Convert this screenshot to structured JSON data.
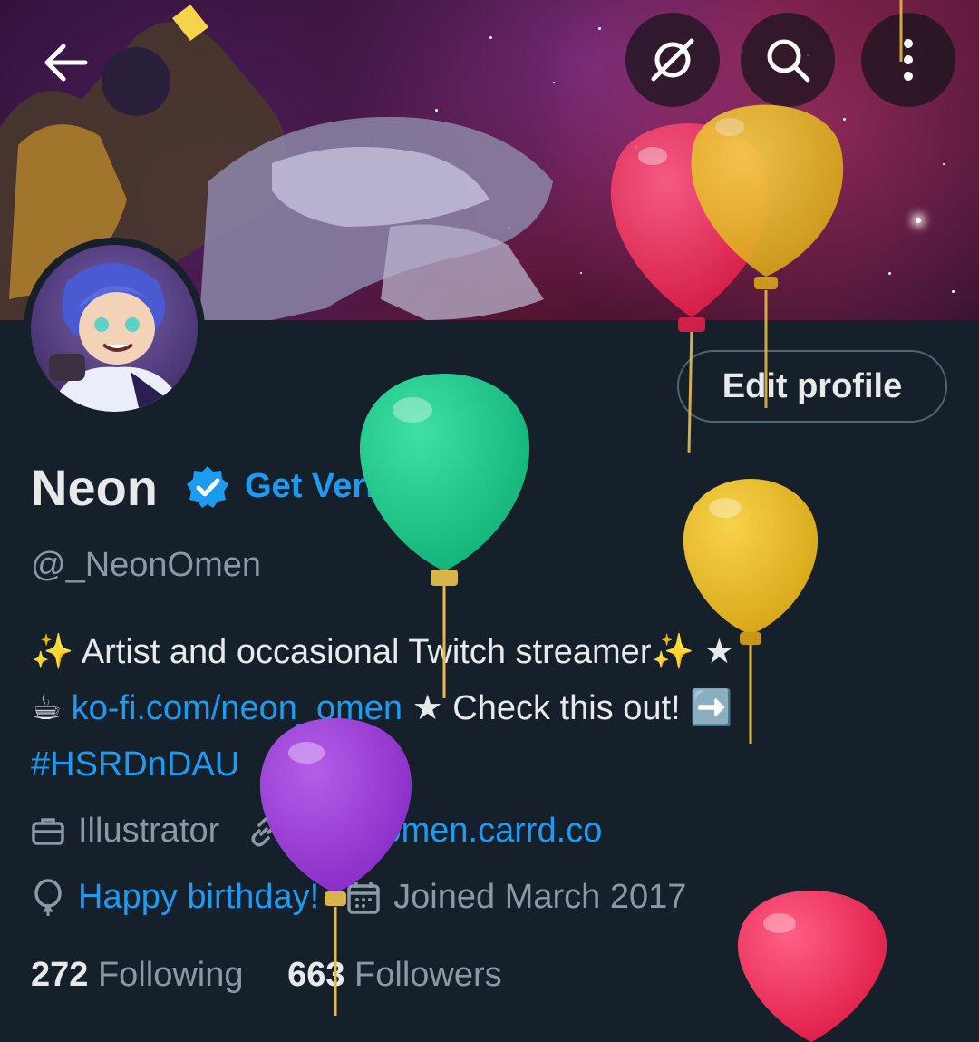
{
  "profile": {
    "name": "Neon",
    "verify_label": "Get Verified",
    "handle": "@_NeonOmen",
    "edit_label": "Edit profile",
    "bio": {
      "line1_emoji": "✨",
      "line1_text": "Artist and occasional Twitch streamer",
      "line1_end": "✨ ★",
      "line2_emoji": "☕",
      "line2_link": "ko-fi.com/neon_omen",
      "line2_text": "★ Check this out!",
      "line2_arrow": "➡️",
      "hashtag": "#HSRDnDAU"
    },
    "profession": "Illustrator",
    "website": "neon-omen.carrd.co",
    "birthday": "Happy birthday!",
    "joined": "Joined March 2017",
    "following_count": "272",
    "following_label": "Following",
    "followers_count": "663",
    "followers_label": "Followers"
  },
  "icons": {
    "back": "arrow-left-icon",
    "grok": "slash-circle-icon",
    "search": "search-icon",
    "more": "more-vertical-icon",
    "verified": "verified-badge-icon",
    "profession": "briefcase-icon",
    "link": "link-icon",
    "birthday": "balloon-icon",
    "calendar": "calendar-icon"
  },
  "colors": {
    "background": "#15202b",
    "accent": "#1d9bf0",
    "muted": "#8b98a5",
    "text": "#e7e9ea"
  }
}
